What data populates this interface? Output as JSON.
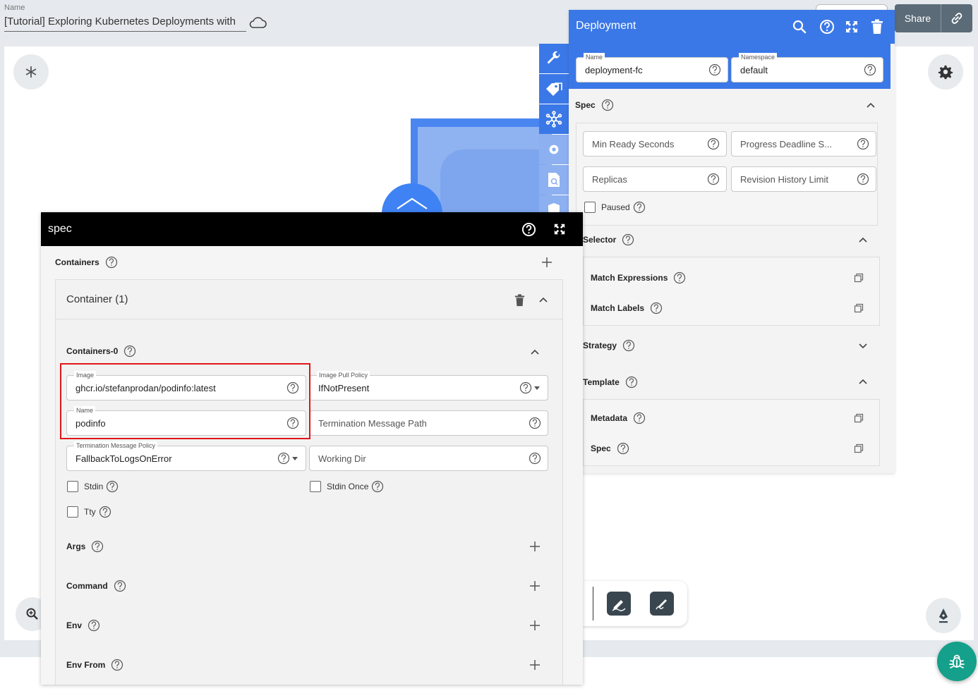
{
  "header": {
    "name_label": "Name",
    "design_title": "[Tutorial] Exploring Kubernetes Deployments with",
    "share_label": "Share"
  },
  "deployment": {
    "title": "Deployment",
    "name_label": "Name",
    "name_value": "deployment-fc",
    "namespace_label": "Namespace",
    "namespace_value": "default",
    "spec_label": "Spec",
    "min_ready_seconds": "Min Ready Seconds",
    "progress_deadline": "Progress Deadline S...",
    "replicas": "Replicas",
    "revision_history_limit": "Revision History Limit",
    "paused": "Paused",
    "selector_label": "Selector",
    "match_expressions": "Match Expressions",
    "match_labels": "Match Labels",
    "strategy_label": "Strategy",
    "template_label": "Template",
    "metadata": "Metadata",
    "spec_item": "Spec"
  },
  "spec_panel": {
    "title": "spec",
    "containers_label": "Containers",
    "container_title": "Container (1)",
    "containers0_label": "Containers-0",
    "image_label": "Image",
    "image_value": "ghcr.io/stefanprodan/podinfo:latest",
    "image_pull_policy_label": "Image Pull Policy",
    "image_pull_policy_value": "IfNotPresent",
    "name_label": "Name",
    "name_value": "podinfo",
    "termination_message_path": "Termination Message Path",
    "termination_message_policy_label": "Termination Message Policy",
    "termination_message_policy_value": "FallbackToLogsOnError",
    "working_dir": "Working Dir",
    "stdin": "Stdin",
    "stdin_once": "Stdin Once",
    "tty": "Tty",
    "args": "Args",
    "command": "Command",
    "env": "Env",
    "env_from": "Env From"
  },
  "colors": {
    "primary_blue": "#3b78e7",
    "spec_header": "#000000",
    "highlight_red": "#e0161a",
    "bug_button": "#14a08a"
  },
  "icons": [
    "cloud-icon",
    "link-icon",
    "search-icon",
    "help-icon",
    "fullscreen-icon",
    "trash-icon",
    "wrench-icon",
    "tag-icon",
    "network-icon",
    "gear-icon",
    "zoom-icon",
    "pen-icon",
    "bug-icon",
    "chevron-up-icon",
    "chevron-down-icon",
    "plus-icon",
    "copy-icon"
  ]
}
